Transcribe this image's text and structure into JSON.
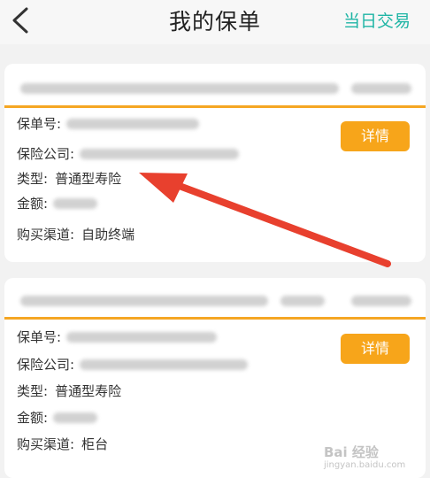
{
  "header": {
    "title": "我的保单",
    "action_label": "当日交易"
  },
  "policies": [
    {
      "policy_no_label": "保单号:",
      "company_label": "保险公司:",
      "type_label": "类型:",
      "type_value": "普通型寿险",
      "amount_label": "金额:",
      "channel_label": "购买渠道:",
      "channel_value": "自助终端",
      "detail_label": "详情"
    },
    {
      "policy_no_label": "保单号:",
      "company_label": "保险公司:",
      "type_label": "类型:",
      "type_value": "普通型寿险",
      "amount_label": "金额:",
      "channel_label": "购买渠道:",
      "channel_value": "柜台",
      "detail_label": "详情"
    }
  ],
  "colors": {
    "accent_orange": "#f7a51a",
    "header_action": "#1fb5a5",
    "annotation_arrow": "#e8402e"
  },
  "icons": {
    "back": "chevron-left-icon",
    "annotation": "red-arrow-icon"
  }
}
